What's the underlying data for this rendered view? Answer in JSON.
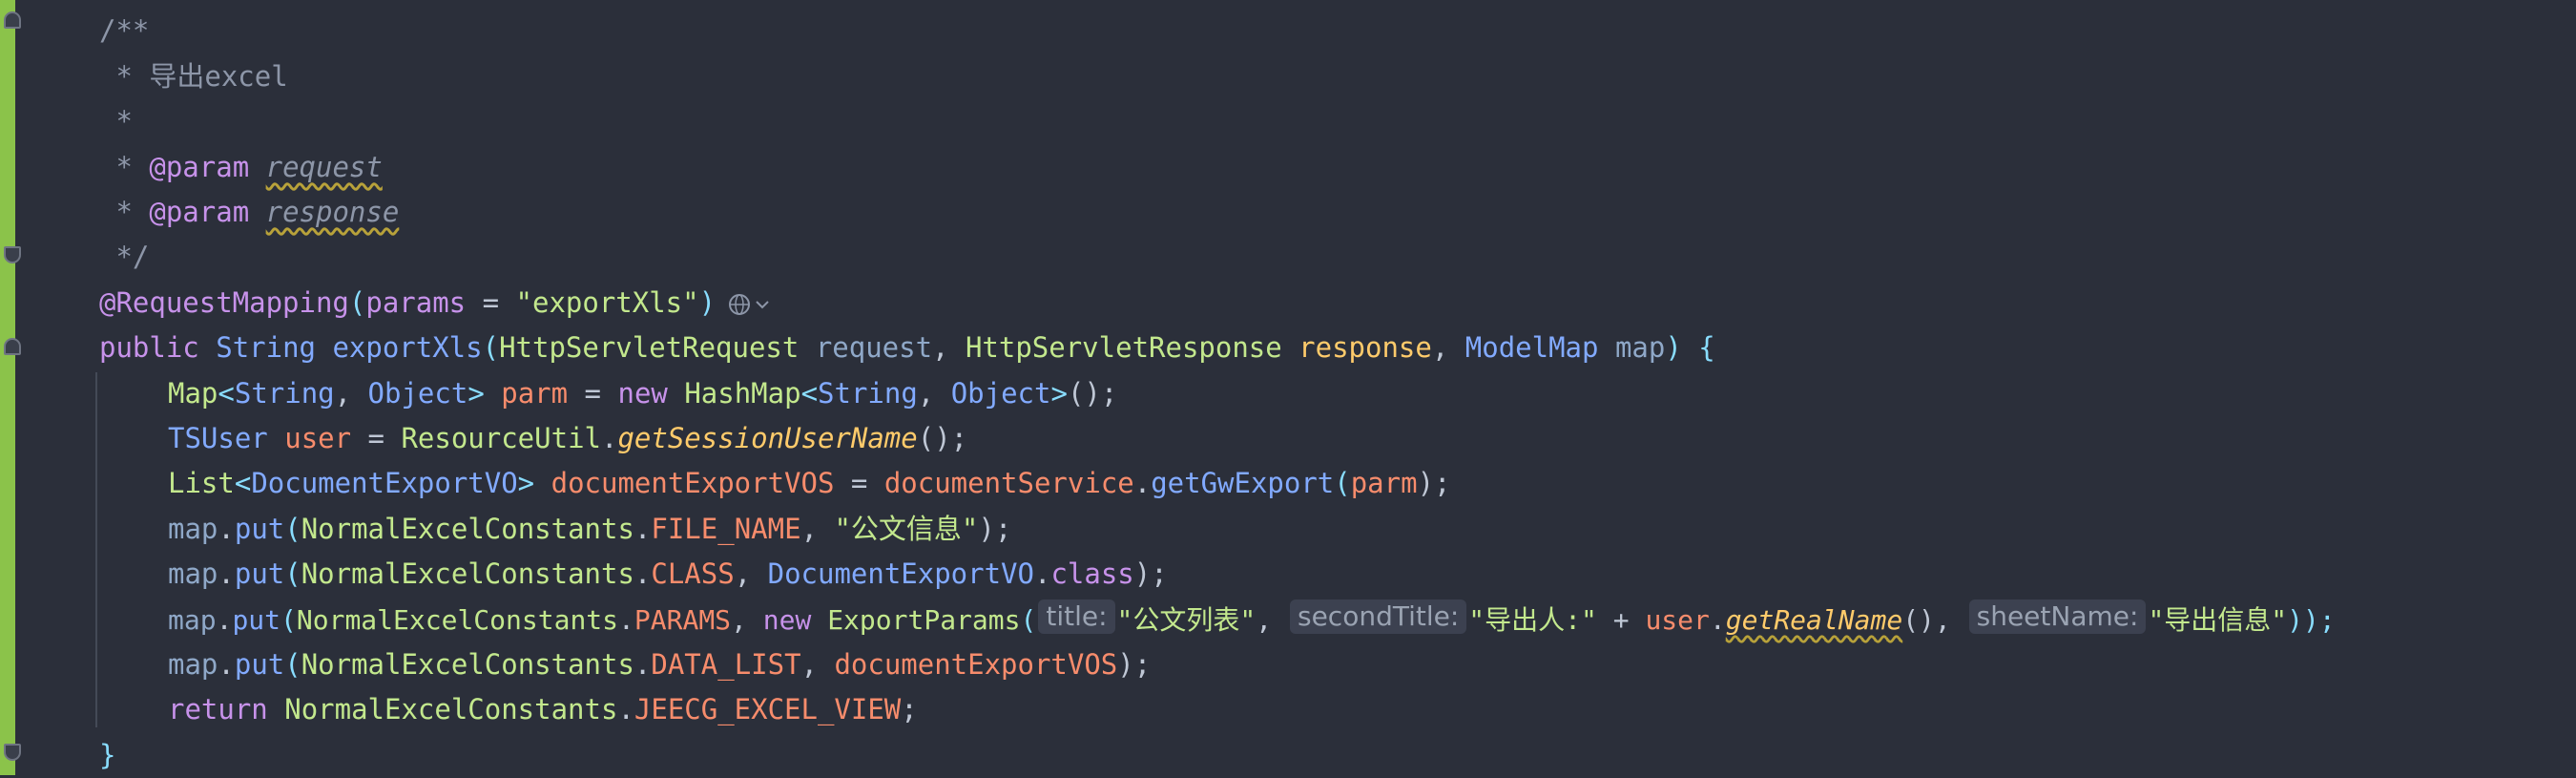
{
  "doc": {
    "line1": "/**",
    "line2": " * 导出excel",
    "line3": " *",
    "line4_star": " * ",
    "line4_tag": "@param",
    "line4_name": "request",
    "line5_star": " * ",
    "line5_tag": "@param",
    "line5_name": "response",
    "line6": " */"
  },
  "annotation": {
    "name": "@RequestMapping",
    "open": "(",
    "attr": "params",
    "eq": " = ",
    "value": "\"exportXls\"",
    "close": ")"
  },
  "signature": {
    "kw": "public",
    "ret": "String",
    "name": "exportXls",
    "open": "(",
    "t1": "HttpServletRequest",
    "p1": "request",
    "t2": "HttpServletResponse",
    "p2": "response",
    "t3": "ModelMap",
    "p3": "map",
    "close": ")",
    "brace": "{"
  },
  "body": {
    "l1": {
      "map": "Map",
      "lt": "<",
      "s": "String",
      "c": ", ",
      "o": "Object",
      "gt": ">",
      "var": "parm",
      "eq": " = ",
      "new": "new",
      "hm": "HashMap",
      "lt2": "<",
      "s2": "String",
      "c2": ", ",
      "o2": "Object",
      "gt2": ">",
      "call": "();"
    },
    "l2": {
      "t": "TSUser",
      "var": "user",
      "eq": " = ",
      "cls": "ResourceUtil",
      "dot": ".",
      "fn": "getSessionUserName",
      "end": "();"
    },
    "l3": {
      "list": "List",
      "lt": "<",
      "t": "DocumentExportVO",
      "gt": ">",
      "var": "documentExportVOS",
      "eq": " = ",
      "svc": "documentService",
      "dot": ".",
      "fn": "getGwExport",
      "open": "(",
      "arg": "parm",
      "end": ");"
    },
    "l4": {
      "map": "map",
      "dot": ".",
      "fn": "put",
      "open": "(",
      "cls": "NormalExcelConstants",
      "dot2": ".",
      "konst": "FILE_NAME",
      "sep": ", ",
      "str": "\"公文信息\"",
      "end": ");"
    },
    "l5": {
      "map": "map",
      "dot": ".",
      "fn": "put",
      "open": "(",
      "cls": "NormalExcelConstants",
      "dot2": ".",
      "konst": "CLASS",
      "sep": ", ",
      "t": "DocumentExportVO",
      "dot3": ".",
      "kw": "class",
      "end": ");"
    },
    "l6": {
      "map": "map",
      "dot": ".",
      "fn": "put",
      "open": "(",
      "cls": "NormalExcelConstants",
      "dot2": ".",
      "konst": "PARAMS",
      "sep": ", ",
      "new": "new",
      "ep": "ExportParams",
      "open2": "(",
      "h1": "title:",
      "s1": "\"公文列表\"",
      "sep2": ", ",
      "h2": "secondTitle:",
      "s2": "\"导出人:\"",
      "plus": " + ",
      "user": "user",
      "dot3": ".",
      "fn2": "getRealName",
      "call": "()",
      "sep3": ", ",
      "h3": "sheetName:",
      "s3": "\"导出信息\"",
      "end": "));"
    },
    "l7": {
      "map": "map",
      "dot": ".",
      "fn": "put",
      "open": "(",
      "cls": "NormalExcelConstants",
      "dot2": ".",
      "konst": "DATA_LIST",
      "sep": ", ",
      "var": "documentExportVOS",
      "end": ");"
    },
    "l8": {
      "kw": "return",
      "cls": "NormalExcelConstants",
      "dot": ".",
      "konst": "JEECG_EXCEL_VIEW",
      "end": ";"
    }
  },
  "closing": "}",
  "icons": {
    "globe": "globe-icon",
    "chevron": "chevron-down-icon"
  },
  "colors": {
    "background": "#2b2f3a",
    "gutter": "#8bc34a",
    "keyword": "#c792ea",
    "type": "#82aaff",
    "string": "#c3e88d",
    "constant": "#f78c6c",
    "method_italic": "#ffcb6b"
  }
}
